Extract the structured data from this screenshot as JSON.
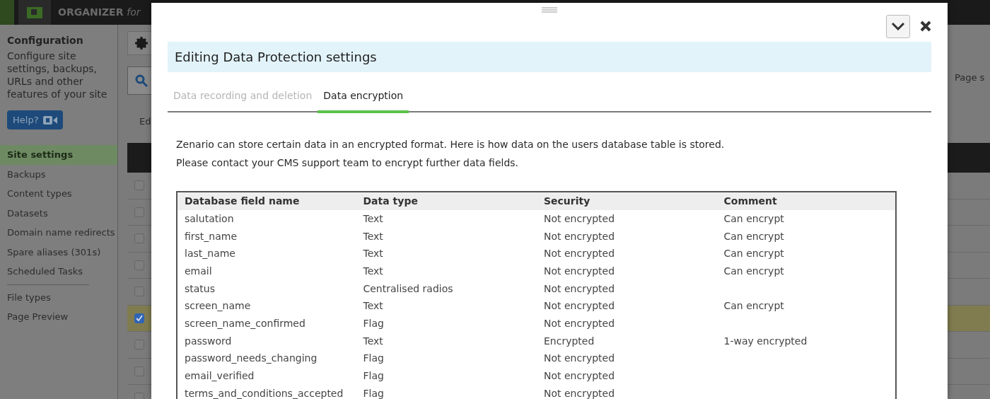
{
  "app": {
    "brand": "ORGANIZER",
    "brand_suffix": "for"
  },
  "sidebar": {
    "title": "Configuration",
    "description": "Configure site settings, backups, URLs and other features of your site",
    "help_button": "Help?",
    "groups": [
      [
        {
          "label": "Site settings",
          "selected": true
        },
        {
          "label": "Backups",
          "selected": false
        },
        {
          "label": "Content types",
          "selected": false
        },
        {
          "label": "Datasets",
          "selected": false
        },
        {
          "label": "Domain name redirects",
          "selected": false
        },
        {
          "label": "Spare aliases (301s)",
          "selected": false
        },
        {
          "label": "Scheduled Tasks",
          "selected": false
        }
      ],
      [
        {
          "label": "File types",
          "selected": false
        },
        {
          "label": "Page Preview",
          "selected": false
        }
      ]
    ]
  },
  "main": {
    "toolbar_label": "Ed",
    "side_label": "Page s",
    "rows": [
      {
        "selected": false
      },
      {
        "selected": false
      },
      {
        "selected": false
      },
      {
        "selected": false
      },
      {
        "selected": false
      },
      {
        "selected": true
      },
      {
        "selected": false
      },
      {
        "selected": false
      },
      {
        "selected": false
      }
    ]
  },
  "dialog": {
    "title": "Editing Data Protection settings",
    "tabs": [
      {
        "label": "Data recording and deletion",
        "selected": false
      },
      {
        "label": "Data encryption",
        "selected": true
      }
    ],
    "intro": [
      "Zenario can store certain data in an encrypted format. Here is how data on the users database table is stored.",
      "Please contact your CMS support team to encrypt further data fields."
    ],
    "table": {
      "columns": [
        "Database field name",
        "Data type",
        "Security",
        "Comment"
      ],
      "rows": [
        [
          "salutation",
          "Text",
          "Not encrypted",
          "Can encrypt"
        ],
        [
          "first_name",
          "Text",
          "Not encrypted",
          "Can encrypt"
        ],
        [
          "last_name",
          "Text",
          "Not encrypted",
          "Can encrypt"
        ],
        [
          "email",
          "Text",
          "Not encrypted",
          "Can encrypt"
        ],
        [
          "status",
          "Centralised radios",
          "Not encrypted",
          ""
        ],
        [
          "screen_name",
          "Text",
          "Not encrypted",
          "Can encrypt"
        ],
        [
          "screen_name_confirmed",
          "Flag",
          "Not encrypted",
          ""
        ],
        [
          "password",
          "Text",
          "Encrypted",
          "1-way encrypted"
        ],
        [
          "password_needs_changing",
          "Flag",
          "Not encrypted",
          ""
        ],
        [
          "email_verified",
          "Flag",
          "Not encrypted",
          ""
        ],
        [
          "terms_and_conditions_accepted",
          "Flag",
          "Not encrypted",
          ""
        ]
      ]
    }
  }
}
